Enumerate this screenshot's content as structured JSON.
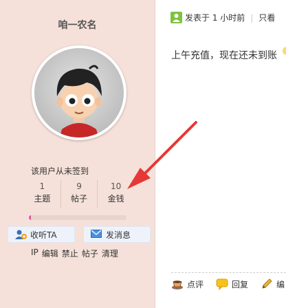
{
  "profile": {
    "username": "咱一农名",
    "signin_status": "该用户从未签到",
    "stats": [
      {
        "value": "1",
        "label": "主题"
      },
      {
        "value": "9",
        "label": "帖子"
      },
      {
        "value": "10",
        "label": "金钱"
      }
    ],
    "progress_fraction": 0.02,
    "follow_label": "收听TA",
    "message_label": "发消息",
    "admin_links": [
      "IP",
      "编辑",
      "禁止",
      "帖子",
      "清理"
    ]
  },
  "post": {
    "meta_posted": "发表于 1 小时前",
    "meta_only_view": "只看",
    "content": "上午充值，现在还未到账"
  },
  "actions": {
    "rate": "点评",
    "reply": "回复",
    "edit": "编"
  },
  "colors": {
    "sidebar_bg": "#f5e1d9",
    "arrow": "#e53935",
    "progress_fill": "#e94ea0",
    "button_bg": "#eef3fb"
  }
}
